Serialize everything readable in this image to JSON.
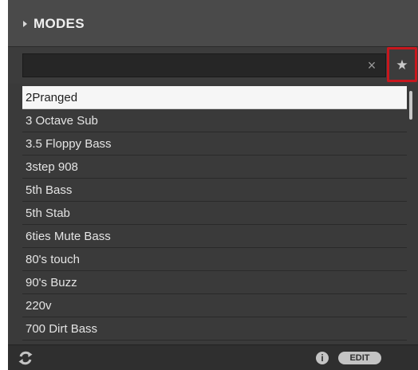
{
  "header": {
    "title": "MODES",
    "collapse_icon": "triangle-right-icon"
  },
  "search": {
    "value": "",
    "placeholder": "",
    "clear_icon": "close-icon",
    "clear_glyph": "×",
    "favorite_icon": "star-icon",
    "favorite_glyph": "★"
  },
  "list": {
    "selected_index": 0,
    "items": [
      "2Pranged",
      "3 Octave Sub",
      "3.5 Floppy Bass",
      "3step 908",
      "5th Bass",
      "5th Stab",
      "6ties Mute Bass",
      "80's touch",
      "90's Buzz",
      "220v",
      "700 Dirt Bass"
    ]
  },
  "footer": {
    "refresh_icon": "refresh-icon",
    "info_icon": "info-icon",
    "info_glyph": "i",
    "edit_label": "EDIT"
  },
  "colors": {
    "highlight_border": "#c8171d",
    "selected_row": "#f6f6f6",
    "panel_bg": "#3a3a3a"
  }
}
